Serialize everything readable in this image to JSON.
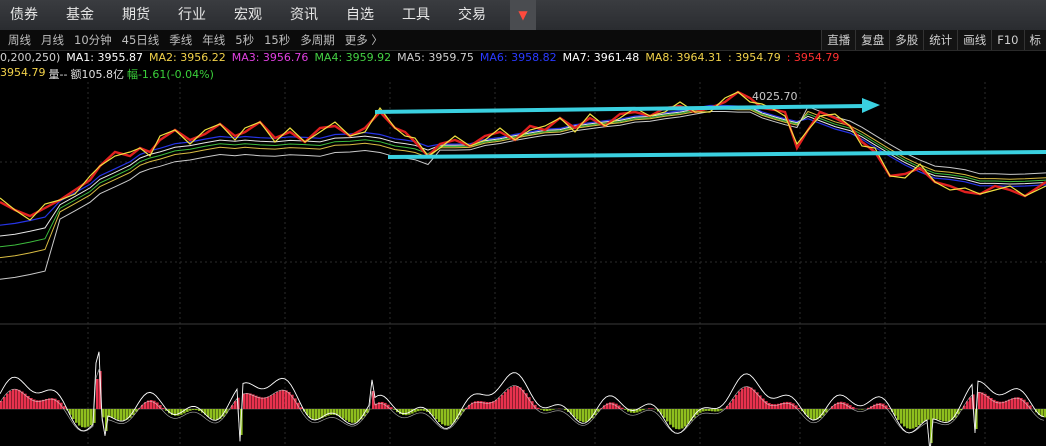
{
  "nav": {
    "items": [
      "债券",
      "基金",
      "期货",
      "行业",
      "宏观",
      "资讯",
      "自选",
      "工具",
      "交易"
    ],
    "arrow_glyph": "▼"
  },
  "toolbar": {
    "periods": [
      "周线",
      "月线",
      "10分钟",
      "45日线",
      "季线",
      "年线",
      "5秒",
      "15秒",
      "多周期",
      "更多 〉"
    ],
    "buttons": [
      "直播",
      "复盘",
      "多股",
      "统计",
      "画线",
      "F10",
      "标"
    ]
  },
  "ma_bar": {
    "param": "0,200,250)",
    "items": [
      {
        "label": "MA1: 3955.87",
        "color": "#ffffff"
      },
      {
        "label": "MA2: 3956.22",
        "color": "#f2d24a"
      },
      {
        "label": "MA3: 3956.76",
        "color": "#e040e0"
      },
      {
        "label": "MA4: 3959.92",
        "color": "#44d044"
      },
      {
        "label": "MA5: 3959.75",
        "color": "#cfcfcf"
      },
      {
        "label": "MA6: 3958.82",
        "color": "#2a3aff"
      },
      {
        "label": "MA7: 3961.48",
        "color": "#ffffff"
      },
      {
        "label": "MA8: 3964.31",
        "color": "#f2d24a"
      },
      {
        "label": ": 3954.79",
        "color": "#f2d24a"
      },
      {
        "label": ": 3954.79",
        "color": "#ff3030"
      }
    ]
  },
  "volume_bar": {
    "price": "3954.79",
    "vol_label": "量--",
    "amount": "额105.8亿",
    "change": "幅-1.61(-0.04%)"
  },
  "annotations": {
    "high_label": "4025.70"
  },
  "colors": {
    "kline": "#e02020",
    "price": "#f0e040",
    "trend_arrow": "#3ad0e0",
    "macd_up": "#e8324e",
    "macd_down": "#8fbf1e",
    "grid": "#2b2b2b"
  }
}
